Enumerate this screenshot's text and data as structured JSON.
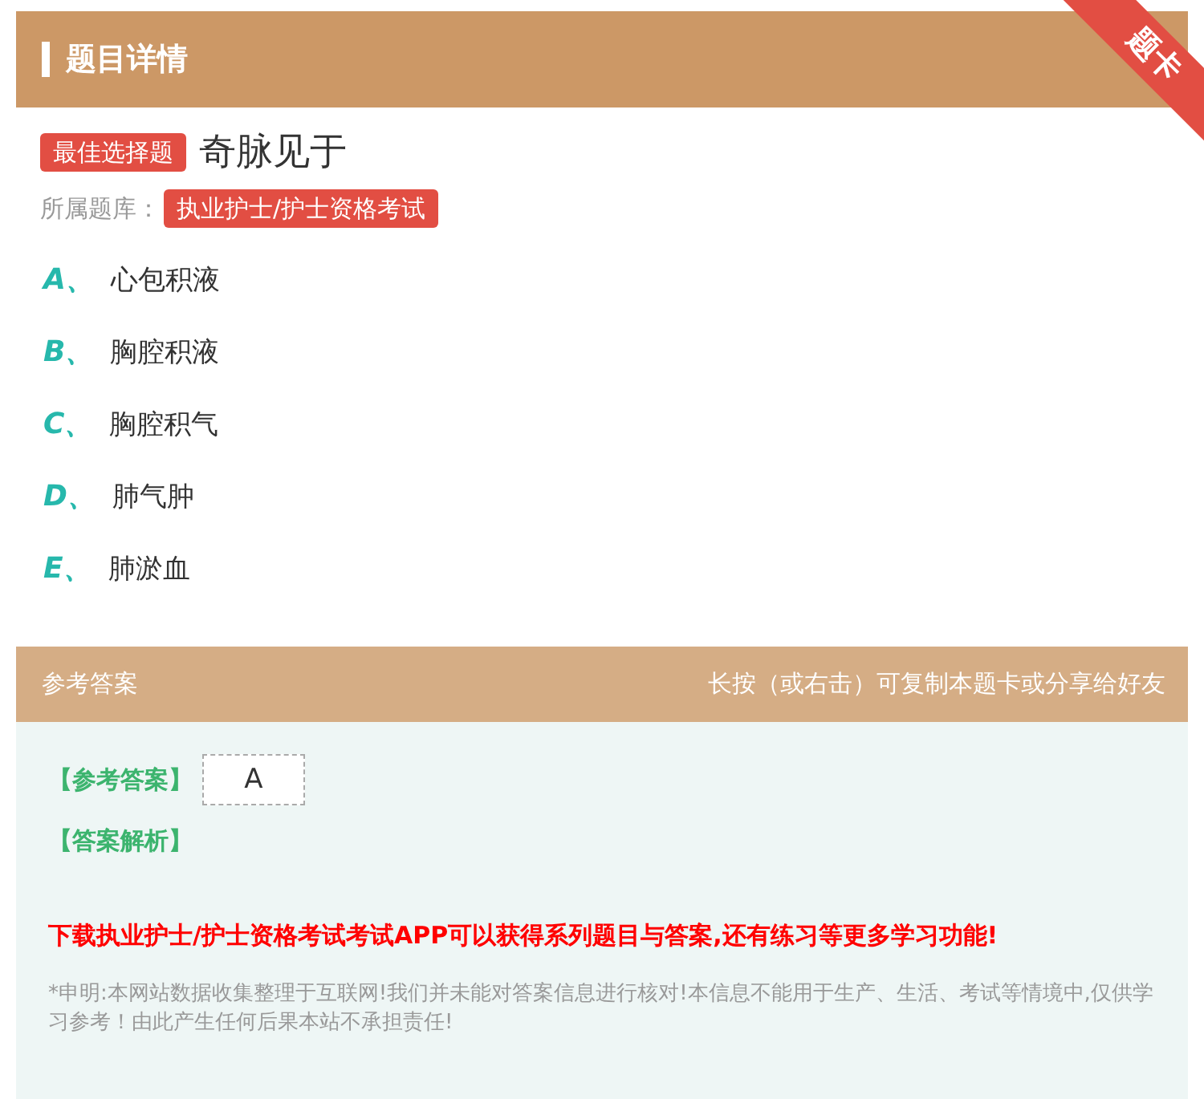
{
  "header": {
    "title": "题目详情",
    "ribbon": "题卡"
  },
  "question": {
    "type_tag": "最佳选择题",
    "text": "奇脉见于",
    "bank_label": "所属题库：",
    "bank": "执业护士/护士资格考试"
  },
  "options": [
    {
      "letter": "A、",
      "text": "心包积液"
    },
    {
      "letter": "B、",
      "text": "胸腔积液"
    },
    {
      "letter": "C、",
      "text": "胸腔积气"
    },
    {
      "letter": "D、",
      "text": "肺气肿"
    },
    {
      "letter": "E、",
      "text": "肺淤血"
    }
  ],
  "answer_bar": {
    "title": "参考答案",
    "hint": "长按（或右击）可复制本题卡或分享给好友"
  },
  "answer": {
    "label": "【参考答案】",
    "value": "A",
    "analysis_label": "【答案解析】"
  },
  "promo": "下载执业护士/护士资格考试考试APP可以获得系列题目与答案,还有练习等更多学习功能!",
  "disclaimer": "*申明:本网站数据收集整理于互联网!我们并未能对答案信息进行核对!本信息不能用于生产、生活、考试等情境中,仅供学习参考！由此产生任何后果本站不承担责任!"
}
